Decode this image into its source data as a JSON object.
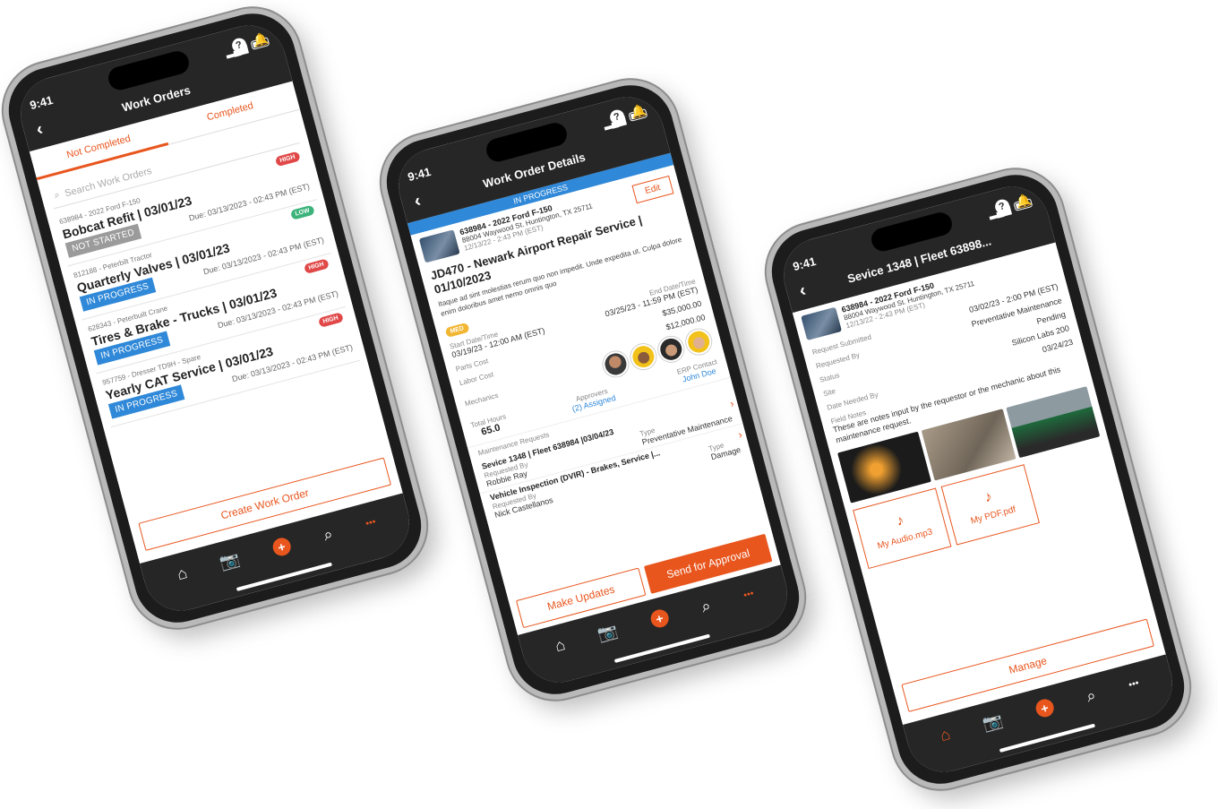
{
  "status_time": "9:41",
  "colors": {
    "brand": "#e8561e",
    "in_progress": "#2f88d8",
    "not_started": "#9b9b9b",
    "high": "#e04848",
    "low": "#3bb37a",
    "med": "#f2b632"
  },
  "icons": {
    "back": "chevron-left-icon",
    "help": "question-icon",
    "bell": "bell-icon",
    "home": "home-icon",
    "camera": "camera-icon",
    "add": "plus-icon",
    "search": "search-icon",
    "more": "more-icon"
  },
  "nav": {
    "back": "‹",
    "help": "?",
    "bell": "🔔",
    "home": "⌂",
    "camera": "📷",
    "add": "+",
    "search": "⌕",
    "more": "•••"
  },
  "screen1": {
    "title": "Work Orders",
    "tabs": {
      "not_completed": "Not Completed",
      "completed": "Completed"
    },
    "search_placeholder": "Search Work Orders",
    "orders": [
      {
        "sub": "638984 - 2022 Ford F-150",
        "title": "Bobcat Refit | 03/01/23",
        "due": "Due: 03/13/2023 - 02:43 PM (EST)",
        "status": "NOT STARTED",
        "priority": "HIGH"
      },
      {
        "sub": "812188 - Peterbilt Tractor",
        "title": "Quarterly Valves | 03/01/23",
        "due": "Due: 03/13/2023 - 02:43 PM (EST)",
        "status": "IN PROGRESS",
        "priority": "LOW"
      },
      {
        "sub": "628343 - Peterbuilt Crane",
        "title": "Tires & Brake - Trucks | 03/01/23",
        "due": "Due: 03/13/2023 - 02:43 PM (EST)",
        "status": "IN PROGRESS",
        "priority": "HIGH"
      },
      {
        "sub": "957759 - Dresser TD9H - Spare",
        "title": "Yearly CAT Service | 03/01/23",
        "due": "Due: 03/13/2023 - 02:43 PM (EST)",
        "status": "IN PROGRESS",
        "priority": "HIGH"
      }
    ],
    "create_button": "Create Work Order"
  },
  "screen2": {
    "title": "Work Order Details",
    "status_bar": "IN PROGRESS",
    "vehicle": {
      "name": "638984 - 2022 Ford F-150",
      "address": "88004 Waywood St. Huntington, TX 25711",
      "date": "12/13/22 - 2:43 PM (EST)"
    },
    "edit": "Edit",
    "wo_title": "JD470 - Newark Airport Repair Service | 01/10/2023",
    "description": "Itaque ad sint molestias rerum quo non impedit. Unde expedita ut. Culpa dolore enim doloribus amet nemo omnis quo",
    "priority": "MED",
    "start_label": "Start Date/Time",
    "start_value": "03/19/23 - 12:00 AM (EST)",
    "end_label": "End Date/Time",
    "end_value": "03/25/23 - 11:59 PM (EST)",
    "parts_label": "Parts Cost",
    "parts_value": "$35,000.00",
    "labor_label": "Labor Cost",
    "labor_value": "$12,000.00",
    "mechanics_label": "Mechanics",
    "total_hours_label": "Total Hours",
    "total_hours_value": "65.0",
    "approvers_label": "Approvers",
    "approvers_value": "(2) Assigned",
    "erp_label": "ERP Contact",
    "erp_value": "John Doe",
    "maint_label": "Maintenance Requests",
    "requests": [
      {
        "title": "Sevice 1348 | Fleet 638984 |03/04/23",
        "req_label": "Requested By",
        "req_value": "Robbie Ray",
        "type_label": "Type",
        "type_value": "Preventative Maintenance"
      },
      {
        "title": "Vehicle Inspection (DVIR) - Brakes, Service |...",
        "req_label": "Requested By",
        "req_value": "Nick Castellanos",
        "type_label": "Type",
        "type_value": "Damage"
      }
    ],
    "make_updates": "Make Updates",
    "send_approval": "Send for Approval"
  },
  "screen3": {
    "title": "Sevice 1348 | Fleet 63898...",
    "vehicle": {
      "name": "638984 - 2022 Ford F-150",
      "address": "88004 Waywood St. Huntington, TX 25711",
      "date": "12/13/22 - 2:43 PM (EST)"
    },
    "fields": [
      {
        "label": "Request Submitted",
        "value": "03/02/23 - 2:00 PM (EST)"
      },
      {
        "label": "Requested By",
        "value": "Preventative Maintenance"
      },
      {
        "label": "Status",
        "value": "Pending"
      },
      {
        "label": "Site",
        "value": "Silicon Labs 200"
      },
      {
        "label": "Date Needed By",
        "value": "03/24/23"
      }
    ],
    "notes_label": "Field Notes",
    "notes": "These are notes input by the requestor or the mechanic about this maintenance request.",
    "files": [
      "My Audio.mp3",
      "My PDF.pdf"
    ],
    "manage": "Manage"
  }
}
